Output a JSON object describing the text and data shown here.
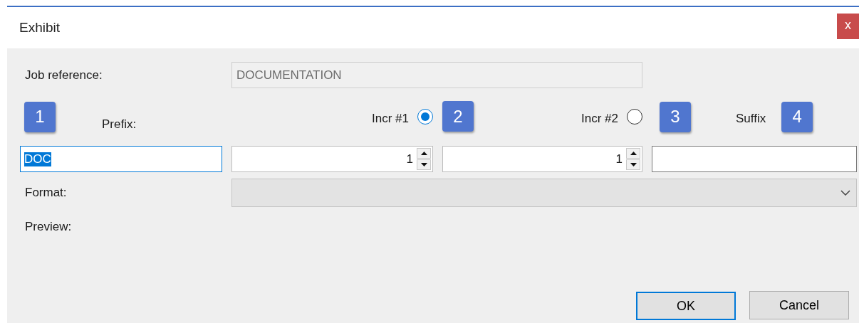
{
  "window": {
    "title": "Exhibit",
    "close": "x"
  },
  "job_reference": {
    "label": "Job reference:",
    "value": "DOCUMENTATION",
    "disabled": true
  },
  "badges": [
    "1",
    "2",
    "3",
    "4"
  ],
  "prefix": {
    "label": "Prefix:",
    "value": "DOC",
    "focused": true
  },
  "increments": [
    {
      "label": "Incr #1",
      "selected": true,
      "value": "1"
    },
    {
      "label": "Incr #2",
      "selected": false,
      "value": "1"
    }
  ],
  "suffix": {
    "label": "Suffix"
  },
  "format": {
    "label": "Format:",
    "disabled": true
  },
  "preview": {
    "label": "Preview:"
  },
  "buttons": [
    {
      "label": "OK",
      "default": true
    },
    {
      "label": "Cancel",
      "default": false
    }
  ]
}
